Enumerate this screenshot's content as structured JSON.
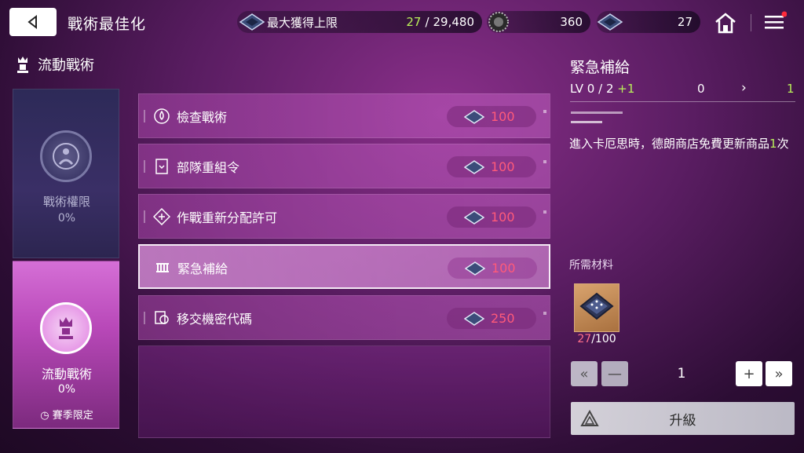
{
  "header": {
    "title": "戰術最佳化",
    "resources": [
      {
        "label": "最大獲得上限",
        "current": "27",
        "sep": "/",
        "max": "29,480",
        "icon": "chip-icon"
      },
      {
        "value": "360",
        "icon": "gear-token-icon"
      },
      {
        "value": "27",
        "icon": "chip-icon"
      }
    ]
  },
  "sidebar": {
    "category": "流動戰術",
    "cards": [
      {
        "name": "戰術權限",
        "percent": "0%"
      },
      {
        "name": "流動戰術",
        "percent": "0%",
        "note": "賽季限定"
      }
    ]
  },
  "list": {
    "items": [
      {
        "label": "檢查戰術",
        "cost": "100",
        "icon": "lotus-icon"
      },
      {
        "label": "部隊重組令",
        "cost": "100",
        "icon": "card-icon"
      },
      {
        "label": "作戰重新分配許可",
        "cost": "100",
        "icon": "diamond-icon"
      },
      {
        "label": "緊急補給",
        "cost": "100",
        "icon": "supply-icon",
        "selected": true
      },
      {
        "label": "移交機密代碼",
        "cost": "250",
        "icon": "document-icon"
      }
    ]
  },
  "detail": {
    "title": "緊急補給",
    "lv_prefix": "LV",
    "lv_current": "0",
    "lv_sep": "/",
    "lv_max": "2",
    "lv_plus": "+1",
    "from_value": "0",
    "to_value": "1",
    "desc_pre": "進入卡厄思時，德朗商店免費更新商品",
    "desc_num": "1",
    "desc_post": "次",
    "materials_title": "所需材料",
    "material_have": "27",
    "material_sep": "/",
    "material_need": "100",
    "quantity": "1",
    "upgrade_label": "升級"
  },
  "colors": {
    "accent_green": "#b9f05a",
    "cost_red": "#ff5a7a",
    "material_red": "#ff6f8a"
  }
}
